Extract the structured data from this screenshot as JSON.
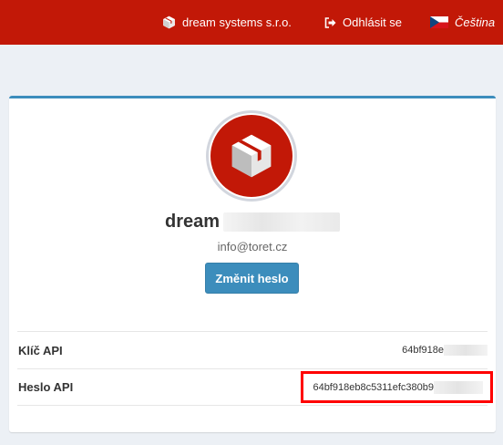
{
  "header": {
    "company": "dream systems s.r.o.",
    "logout_label": "Odhlásit se",
    "language_label": "Čeština"
  },
  "profile": {
    "name": "dream",
    "email": "info@toret.cz",
    "change_password_label": "Změnit heslo"
  },
  "api": {
    "key_label": "Klíč API",
    "key_value": "64bf918e",
    "password_label": "Heslo API",
    "password_value": "64bf918eb8c5311efc380b9"
  },
  "colors": {
    "header_bg": "#c21807",
    "primary_button": "#3c8dbc",
    "highlight": "#ff0000"
  }
}
